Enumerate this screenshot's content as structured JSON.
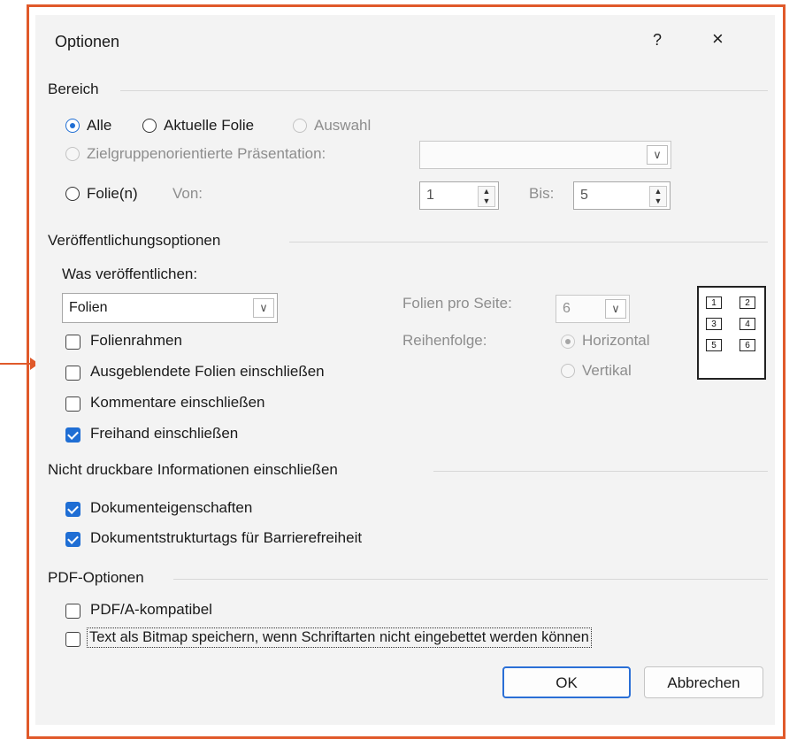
{
  "dialog": {
    "title": "Optionen",
    "help_label": "?",
    "close_label": "×"
  },
  "range": {
    "section_title": "Bereich",
    "all_label": "Alle",
    "current_slide_label": "Aktuelle Folie",
    "selection_label": "Auswahl",
    "custom_show_label": "Zielgruppenorientierte Präsentation:",
    "custom_show_value": "",
    "slides_label": "Folie(n)",
    "from_label": "Von:",
    "from_value": "1",
    "to_label": "Bis:",
    "to_value": "5"
  },
  "publish": {
    "section_title": "Veröffentlichungsoptionen",
    "what_label": "Was veröffentlichen:",
    "what_value": "Folien",
    "slides_per_page_label": "Folien pro Seite:",
    "slides_per_page_value": "6",
    "order_label": "Reihenfolge:",
    "horizontal_label": "Horizontal",
    "vertical_label": "Vertikal",
    "frame_slides_label": "Folienrahmen",
    "hidden_slides_label": "Ausgeblendete Folien einschließen",
    "comments_label": "Kommentare einschließen",
    "ink_label": "Freihand einschließen",
    "preview_numbers": [
      "1",
      "2",
      "3",
      "4",
      "5",
      "6"
    ]
  },
  "nonprint": {
    "section_title": "Nicht druckbare Informationen einschließen",
    "doc_properties_label": "Dokumenteigenschaften",
    "structure_tags_label": "Dokumentstrukturtags für Barrierefreiheit"
  },
  "pdf": {
    "section_title": "PDF-Optionen",
    "pdfa_label": "PDF/A-kompatibel",
    "bitmap_label": "Text als Bitmap speichern, wenn Schriftarten nicht eingebettet werden können"
  },
  "buttons": {
    "ok": "OK",
    "cancel": "Abbrechen"
  },
  "colors": {
    "highlight_border": "#e0592a",
    "accent": "#1f6ed4"
  }
}
